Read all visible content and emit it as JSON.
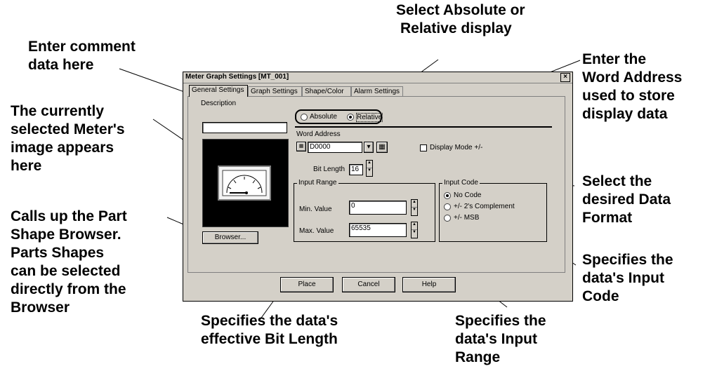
{
  "callouts": {
    "comment": [
      "Enter comment",
      "data here"
    ],
    "image": [
      "The currently",
      "selected Meter's",
      "image appears",
      "here"
    ],
    "browser": [
      "Calls up the Part",
      "Shape Browser.",
      "Parts Shapes",
      "can be selected",
      "directly from the",
      "Browser"
    ],
    "absrel": [
      "Select Absolute or",
      "Relative display"
    ],
    "word_address": [
      "Enter the",
      "Word Address",
      "used to store",
      "display data"
    ],
    "data_format": [
      "Select the",
      "desired Data",
      "Format"
    ],
    "input_code": [
      "Specifies the",
      "data's Input",
      "Code"
    ],
    "bit_length": [
      "Specifies the data's",
      "effective Bit Length"
    ],
    "input_range": [
      "Specifies the",
      "data's Input",
      "Range"
    ]
  },
  "dialog": {
    "title": "Meter Graph Settings [MT_001]",
    "close": "×",
    "tabs": [
      {
        "label": "General Settings",
        "active": true
      },
      {
        "label": "Graph Settings",
        "active": false
      },
      {
        "label": "Shape/Color",
        "active": false
      },
      {
        "label": "Alarm Settings",
        "active": false
      }
    ],
    "description_label": "Description",
    "description_value": "",
    "browser_button": "Browser...",
    "absolute_label": "Absolute",
    "relative_label": "Relative",
    "display_selected": "Relative",
    "word_address_label": "Word Address",
    "word_address_value": "D0000",
    "display_mode_label": "Display Mode +/-",
    "display_mode_checked": false,
    "bit_length_label": "Bit Length",
    "bit_length_value": "16",
    "input_range": {
      "title": "Input Range",
      "min_label": "Min. Value",
      "min_value": "0",
      "max_label": "Max. Value",
      "max_value": "65535"
    },
    "input_code": {
      "title": "Input Code",
      "options": [
        "No Code",
        "+/- 2's Complement",
        "+/- MSB"
      ],
      "selected": "No Code"
    },
    "footer": {
      "place": "Place",
      "cancel": "Cancel",
      "help": "Help"
    }
  }
}
